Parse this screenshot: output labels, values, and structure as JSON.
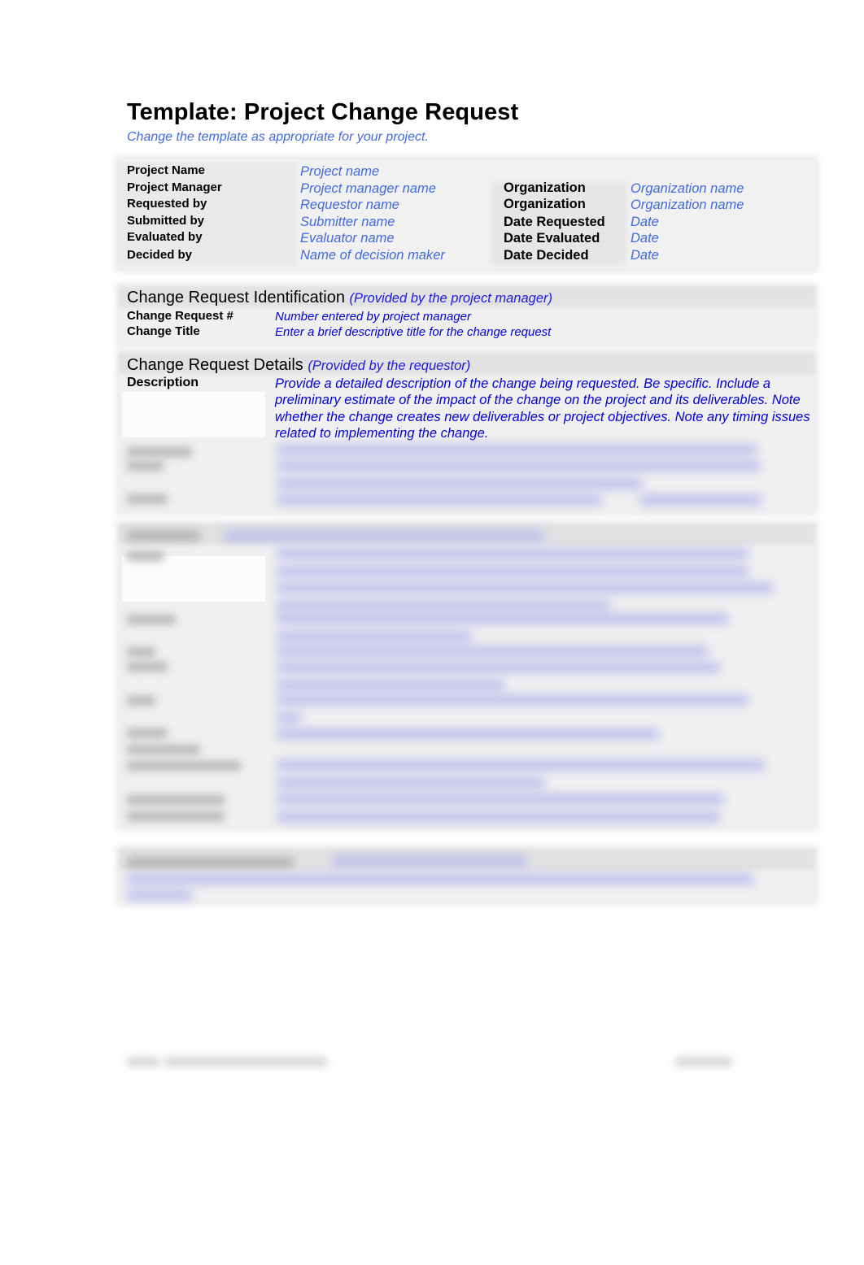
{
  "document": {
    "title": "Template: Project Change Request",
    "subtitle": "Change the template as appropriate for your project."
  },
  "info": {
    "left": [
      {
        "label": "Project Name",
        "value": "Project name"
      },
      {
        "label": "Project Manager",
        "value": "Project manager name"
      },
      {
        "label": "Requested by",
        "value": "Requestor name"
      },
      {
        "label": "Submitted by",
        "value": "Submitter name"
      },
      {
        "label": "Evaluated by",
        "value": "Evaluator name"
      },
      {
        "label": "Decided by",
        "value": "Name of decision maker"
      }
    ],
    "right": [
      {
        "label": "Organization",
        "value": "Organization name"
      },
      {
        "label": "Organization",
        "value": "Organization name"
      },
      {
        "label": "Date Requested",
        "value": "Date"
      },
      {
        "label": "Date Evaluated",
        "value": "Date"
      },
      {
        "label": "Date Decided",
        "value": "Date"
      }
    ]
  },
  "identification": {
    "title": "Change Request Identification",
    "note": "(Provided by the project manager)",
    "rows": [
      {
        "label": "Change Request #",
        "value": "Number entered by project manager"
      },
      {
        "label": "Change Title",
        "value": "Enter a brief descriptive title for the change request"
      }
    ]
  },
  "details": {
    "title": "Change Request Details",
    "note": "(Provided by the requestor)",
    "description_label": "Description",
    "description_value": "Provide a detailed description of the change being requested.  Be specific.  Include a preliminary estimate of the impact of the change on the project and its deliverables.  Note whether the change creates new deliverables or project objectives.  Note any timing issues related to implementing the change."
  },
  "colors": {
    "placeholder_light_blue": "#4169e1",
    "placeholder_dark_blue": "#0000dd",
    "section_background": "#f0f0f0"
  }
}
